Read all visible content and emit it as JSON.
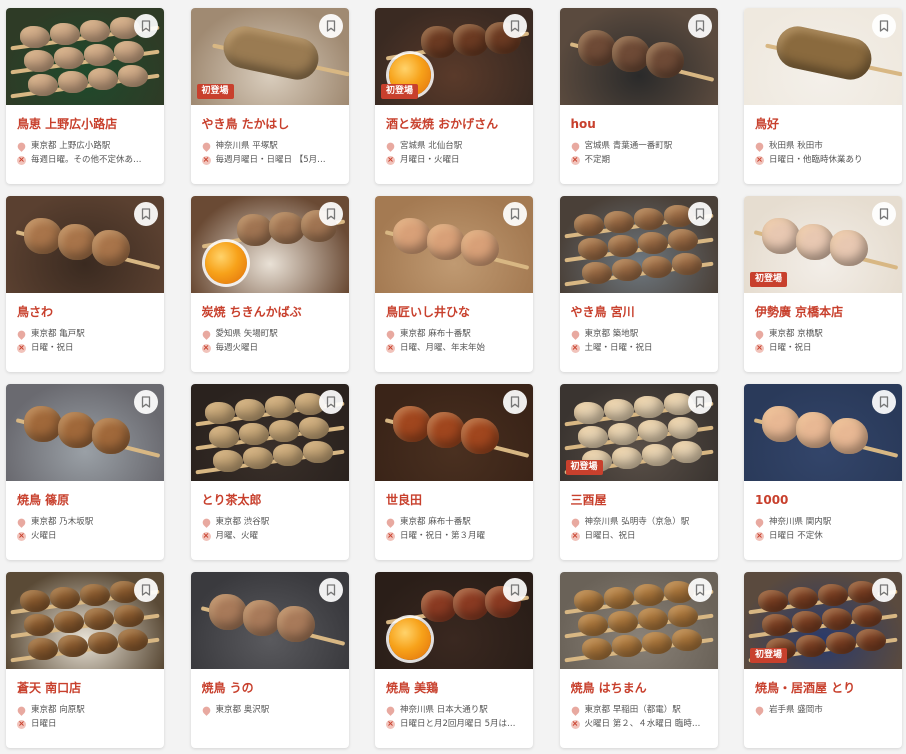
{
  "ui": {
    "new_badge": "初登場"
  },
  "colors": {
    "accent": "#c8402d",
    "text_muted": "#555555",
    "background": "#f3f3f3"
  },
  "icons": {
    "bookmark": "bookmark-icon",
    "location": "location-pin-icon",
    "closed": "closed-day-icon"
  },
  "shops": [
    {
      "name": "鳥恵 上野広小路店",
      "location": "東京都 上野広小路駅",
      "closed": "毎週日曜。その他不定休あ…",
      "new": false,
      "photo": {
        "bg": "#2e3b26",
        "plate": "#1f4a2c",
        "meat": "#c9a483",
        "style": "multi"
      }
    },
    {
      "name": "やき鳥 たかはし",
      "location": "神奈川県 平塚駅",
      "closed": "毎週月曜日・日曜日 【5月…",
      "new": true,
      "photo": {
        "bg": "#a08a72",
        "plate": "#d9cdbd",
        "meat": "#9a7b52",
        "style": "tsukune"
      }
    },
    {
      "name": "酒と炭焼 おかげさん",
      "location": "宮城県 北仙台駅",
      "closed": "月曜日・火曜日",
      "new": true,
      "photo": {
        "bg": "#3a2a22",
        "plate": "#5a3a2a",
        "meat": "#6b3a22",
        "style": "egg"
      }
    },
    {
      "name": "hou",
      "location": "宮城県 青葉通一番町駅",
      "closed": "不定期",
      "new": false,
      "photo": {
        "bg": "#5a4a3e",
        "plate": "#2a2a2a",
        "meat": "#6e4a36",
        "style": "single"
      }
    },
    {
      "name": "鳥好",
      "location": "秋田県 秋田市",
      "closed": "日曜日・他臨時休業あり",
      "new": false,
      "photo": {
        "bg": "#efe9df",
        "plate": "#f4f0ea",
        "meat": "#8a6a3e",
        "style": "tsukune"
      }
    },
    {
      "name": "鳥さわ",
      "location": "東京都 亀戸駅",
      "closed": "日曜・祝日",
      "new": false,
      "photo": {
        "bg": "#5a4030",
        "plate": "#3a2a20",
        "meat": "#a8744a",
        "style": "single"
      }
    },
    {
      "name": "炭焼 ちきんかばぶ",
      "location": "愛知県 矢場町駅",
      "closed": "毎週火曜日",
      "new": false,
      "photo": {
        "bg": "#6a4a34",
        "plate": "#e9e1d6",
        "meat": "#a07452",
        "style": "egg"
      }
    },
    {
      "name": "鳥匠いし井ひな",
      "location": "東京都 麻布十番駅",
      "closed": "日曜、月曜、年末年始",
      "new": false,
      "photo": {
        "bg": "#a47a52",
        "plate": "#c09a72",
        "meat": "#d8a078",
        "style": "single"
      }
    },
    {
      "name": "やき鳥 宮川",
      "location": "東京都 築地駅",
      "closed": "土曜・日曜・祝日",
      "new": false,
      "photo": {
        "bg": "#4a4038",
        "plate": "#6e7880",
        "meat": "#9a6a44",
        "style": "multi"
      }
    },
    {
      "name": "伊勢廣 京橋本店",
      "location": "東京都 京橋駅",
      "closed": "日曜・祝日",
      "new": true,
      "photo": {
        "bg": "#e6ddd0",
        "plate": "#f3eee8",
        "meat": "#e8c8b2",
        "style": "single"
      }
    },
    {
      "name": "焼鳥 篠原",
      "location": "東京都 乃木坂駅",
      "closed": "火曜日",
      "new": false,
      "photo": {
        "bg": "#6a6a70",
        "plate": "#9aa0a6",
        "meat": "#a0683a",
        "style": "single"
      }
    },
    {
      "name": "とり茶太郎",
      "location": "東京都 渋谷駅",
      "closed": "月曜、火曜",
      "new": false,
      "photo": {
        "bg": "#2a221e",
        "plate": "#3a302a",
        "meat": "#c4a476",
        "style": "multi"
      }
    },
    {
      "name": "世良田",
      "location": "東京都 麻布十番駅",
      "closed": "日曜・祝日・第３月曜",
      "new": false,
      "photo": {
        "bg": "#3a2418",
        "plate": "#4a3020",
        "meat": "#a0461e",
        "style": "single"
      }
    },
    {
      "name": "三酉屋",
      "location": "神奈川県 弘明寺（京急）駅",
      "closed": "日曜日、祝日",
      "new": true,
      "photo": {
        "bg": "#3a3430",
        "plate": "#5a5048",
        "meat": "#e6d2b2",
        "style": "multi"
      }
    },
    {
      "name": "1000",
      "location": "神奈川県 関内駅",
      "closed": "日曜日 不定休",
      "new": false,
      "photo": {
        "bg": "#2a3a5a",
        "plate": "#33456a",
        "meat": "#e8b894",
        "style": "single"
      }
    },
    {
      "name": "蒼天 南口店",
      "location": "東京都 向原駅",
      "closed": "日曜日",
      "new": false,
      "photo": {
        "bg": "#5a4a36",
        "plate": "#e8e2d6",
        "meat": "#8a5a2e",
        "style": "multi"
      }
    },
    {
      "name": "焼鳥 うの",
      "location": "東京都 奥沢駅",
      "closed": "",
      "new": false,
      "photo": {
        "bg": "#3a3a3e",
        "plate": "#5a5a5e",
        "meat": "#a87a5a",
        "style": "single"
      }
    },
    {
      "name": "焼鳥 美鶏",
      "location": "神奈川県 日本大通り駅",
      "closed": "日曜日と月2回月曜日 5月は…",
      "new": false,
      "photo": {
        "bg": "#2a1e18",
        "plate": "#3a2820",
        "meat": "#8a3a22",
        "style": "egg"
      }
    },
    {
      "name": "焼鳥 はちまん",
      "location": "東京都 早稲田（都電）駅",
      "closed": "火曜日 第２、４水曜日 臨時…",
      "new": false,
      "photo": {
        "bg": "#6a6258",
        "plate": "#8a8278",
        "meat": "#a8743a",
        "style": "multi"
      }
    },
    {
      "name": "焼鳥・居酒屋 とり",
      "location": "岩手県 盛岡市",
      "closed": "",
      "new": true,
      "photo": {
        "bg": "#5a4a3e",
        "plate": "#2a3a6a",
        "meat": "#7a3e22",
        "style": "multi"
      }
    }
  ]
}
